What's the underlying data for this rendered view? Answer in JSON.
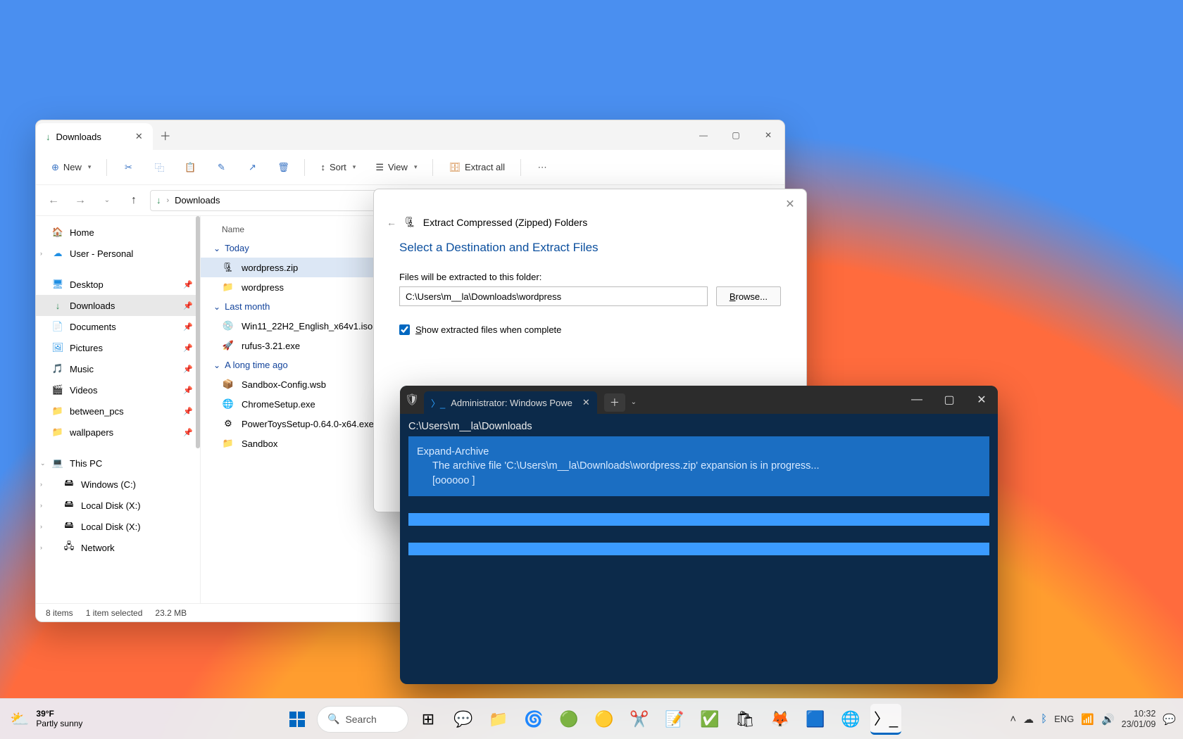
{
  "explorer": {
    "tab_title": "Downloads",
    "toolbar": {
      "new": "New",
      "sort": "Sort",
      "view": "View",
      "extract_all": "Extract all"
    },
    "breadcrumb": "Downloads",
    "column_name": "Name",
    "sidebar": {
      "home": "Home",
      "user": "User - Personal",
      "desktop": "Desktop",
      "downloads": "Downloads",
      "documents": "Documents",
      "pictures": "Pictures",
      "music": "Music",
      "videos": "Videos",
      "between_pcs": "between_pcs",
      "wallpapers": "wallpapers",
      "this_pc": "This PC",
      "drive_c": "Windows (C:)",
      "drive_x1": "Local Disk (X:)",
      "drive_x2": "Local Disk (X:)",
      "network": "Network"
    },
    "groups": {
      "today": "Today",
      "last_month": "Last month",
      "long_ago": "A long time ago"
    },
    "files": {
      "wordpress_zip": "wordpress.zip",
      "wordpress_folder": "wordpress",
      "win11_iso": "Win11_22H2_English_x64v1.iso",
      "rufus": "rufus-3.21.exe",
      "sandbox_config": "Sandbox-Config.wsb",
      "chrome": "ChromeSetup.exe",
      "powertoys": "PowerToysSetup-0.64.0-x64.exe",
      "sandbox": "Sandbox"
    },
    "status": {
      "items": "8 items",
      "selected": "1 item selected",
      "size": "23.2 MB"
    }
  },
  "extract": {
    "title": "Extract Compressed (Zipped) Folders",
    "heading": "Select a Destination and Extract Files",
    "label": "Files will be extracted to this folder:",
    "path": "C:\\Users\\m__la\\Downloads\\wordpress",
    "browse": "Browse...",
    "show_label": "Show extracted files when complete"
  },
  "terminal": {
    "tab_title": "Administrator: Windows Powe",
    "cwd": "C:\\Users\\m__la\\Downloads",
    "cmd": "Expand-Archive",
    "msg": "The archive file 'C:\\Users\\m__la\\Downloads\\wordpress.zip' expansion is in progress...",
    "bar": "[oooooo                                                                         ]"
  },
  "taskbar": {
    "search": "Search",
    "weather_temp": "39°F",
    "weather_desc": "Partly sunny",
    "lang": "ENG",
    "time": "10:32",
    "date": "23/01/09"
  }
}
